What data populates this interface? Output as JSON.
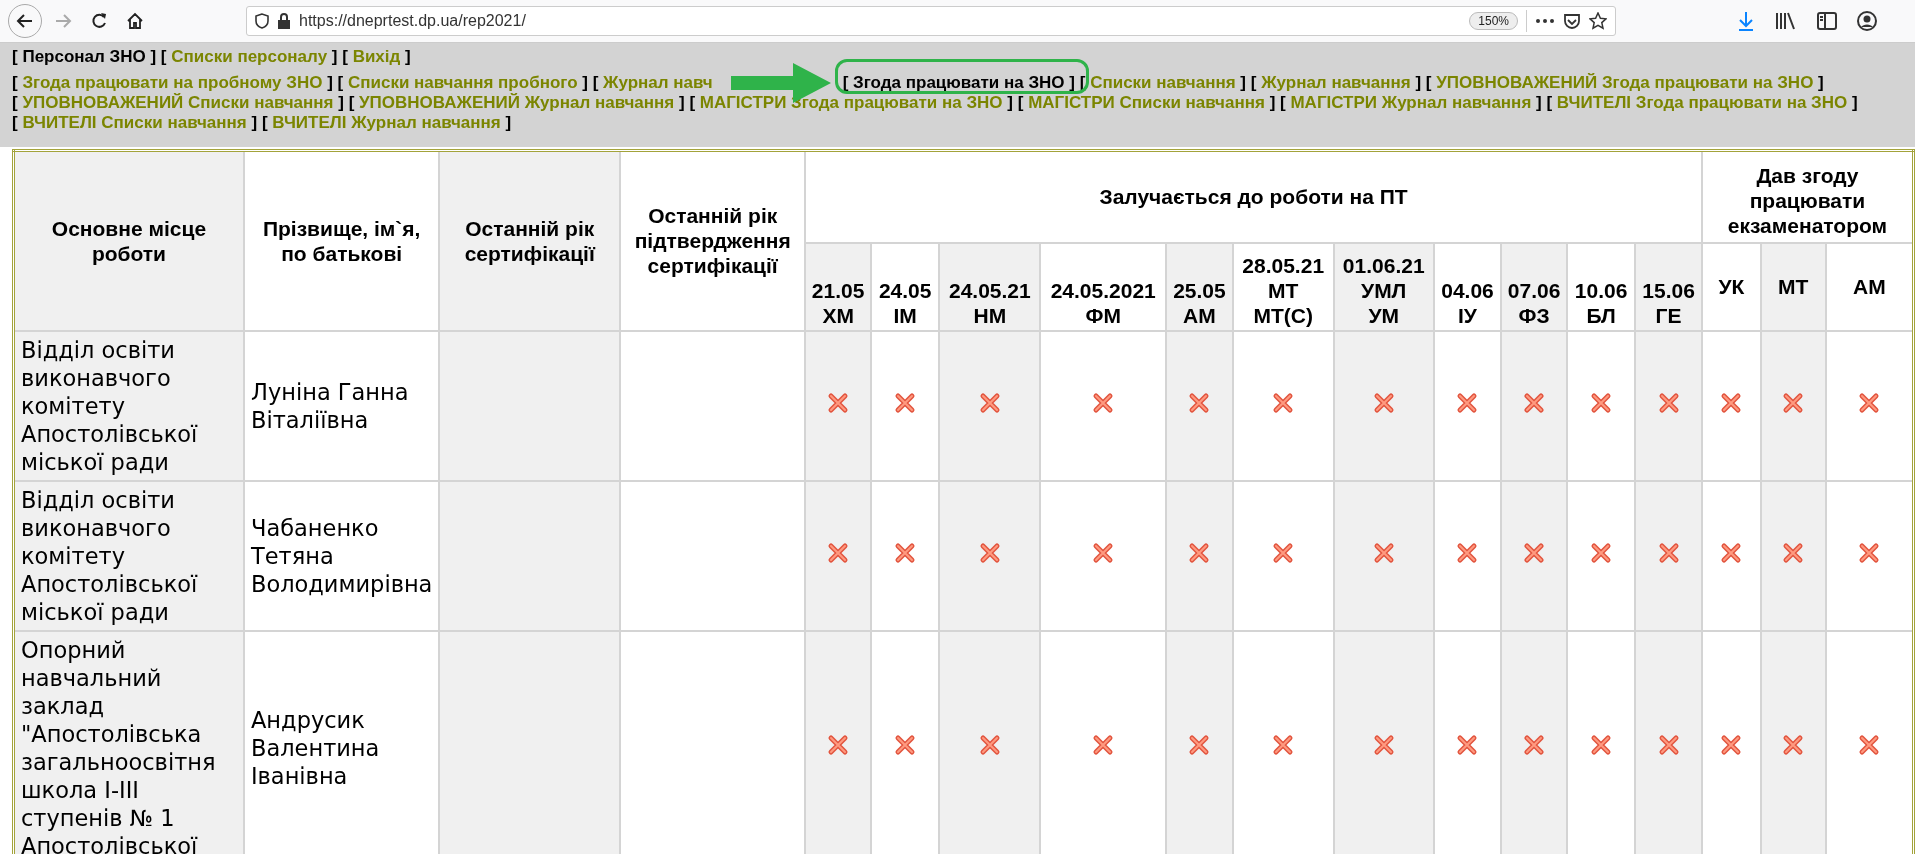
{
  "browser": {
    "url": "https://dneprtest.dp.ua/rep2021/",
    "zoom": "150%"
  },
  "nav": {
    "main": [
      {
        "before": "[",
        "label": "Персонал ЗНО",
        "after": "]",
        "selected": true,
        "highlighted": false
      },
      {
        "before": "[",
        "label": "Списки персоналу",
        "after": "]",
        "selected": false,
        "highlighted": false
      },
      {
        "before": "[",
        "label": "Вихід",
        "after": "]",
        "selected": false,
        "highlighted": false
      }
    ],
    "lines": [
      [
        {
          "before": "[",
          "label": "Згода працювати на пробному ЗНО",
          "after": "]",
          "selected": false,
          "highlighted": false
        },
        {
          "before": "[",
          "label": "Списки навчання пробного",
          "after": "]",
          "selected": false,
          "highlighted": false
        },
        {
          "before": "[",
          "label": "Журнал навч",
          "selected": false,
          "highlighted": false
        },
        {
          "before": "[",
          "label": "Згода працювати на ЗНО",
          "after": "]",
          "selected": true,
          "highlighted": true
        },
        {
          "before": "[",
          "label": "Списки навчання",
          "after": "]",
          "selected": false,
          "highlighted": false
        },
        {
          "before": "[",
          "label": "Журнал навчання",
          "after": "]",
          "selected": false,
          "highlighted": false
        },
        {
          "before": "[",
          "label": "УПОВНОВАЖЕНИЙ Згода працювати на ЗНО",
          "after": "]",
          "selected": false,
          "highlighted": false
        }
      ],
      [
        {
          "before": "[",
          "label": "УПОВНОВАЖЕНИЙ Списки навчання",
          "after": "]",
          "selected": false,
          "highlighted": false
        },
        {
          "before": "[",
          "label": "УПОВНОВАЖЕНИЙ Журнал навчання",
          "after": "]",
          "selected": false,
          "highlighted": false
        },
        {
          "before": "[",
          "label": "МАГІСТРИ Згода працювати на ЗНО",
          "after": "]",
          "selected": false,
          "highlighted": false
        },
        {
          "before": "[",
          "label": "МАГІСТРИ Списки навчання",
          "after": "]",
          "selected": false,
          "highlighted": false
        },
        {
          "before": "[",
          "label": "МАГІСТРИ Журнал навчання",
          "after": "]",
          "selected": false,
          "highlighted": false
        },
        {
          "before": "[",
          "label": "ВЧИТЕЛІ Згода працювати на ЗНО",
          "after": "]",
          "selected": false,
          "highlighted": false
        }
      ],
      [
        {
          "before": "[",
          "label": "ВЧИТЕЛІ Списки навчання",
          "after": "]",
          "selected": false,
          "highlighted": false
        },
        {
          "before": "[",
          "label": "ВЧИТЕЛІ Журнал навчання",
          "after": "]",
          "selected": false,
          "highlighted": false
        }
      ]
    ]
  },
  "table": {
    "columns": [
      "Основне місце роботи",
      "Прізвище, ім`я, по батькові",
      "Останній рік сертифікації",
      "Останній рік підтвердження сертифікації"
    ],
    "pt_group": "Залучається до роботи на ПТ",
    "pt_columns": [
      [
        "21.05",
        "ХМ"
      ],
      [
        "24.05",
        "ІМ"
      ],
      [
        "24.05.21",
        "НМ"
      ],
      [
        "24.05.2021",
        "ФМ"
      ],
      [
        "25.05",
        "АМ"
      ],
      [
        "28.05.21",
        "МТ",
        "МТ(С)"
      ],
      [
        "01.06.21",
        "УМЛ",
        "УМ"
      ],
      [
        "04.06",
        "ІУ"
      ],
      [
        "07.06",
        "ФЗ"
      ],
      [
        "10.06",
        "БЛ"
      ],
      [
        "15.06",
        "ГЕ"
      ]
    ],
    "exam_group": "Дав згоду працювати екзаменатором",
    "exam_columns": [
      "УК",
      "МТ",
      "АМ"
    ],
    "rows": [
      {
        "workplace": "Відділ освіти виконавчого комітету Апостолівської міської ради",
        "name": "Луніна Ганна Віталіївна",
        "pt": [
          {
            "on": false
          },
          {
            "on": false
          },
          {
            "on": false
          },
          {
            "on": false
          },
          {
            "on": false
          },
          {
            "on": false
          },
          {
            "on": false
          },
          {
            "on": false
          },
          {
            "on": false
          },
          {
            "on": false
          },
          {
            "on": false
          }
        ],
        "exam": [
          {
            "on": false
          },
          {
            "on": false
          },
          {
            "on": false
          }
        ]
      },
      {
        "workplace": "Відділ освіти виконавчого комітету Апостолівської міської ради",
        "name": "Чабаненко Тетяна Володимирівна",
        "pt": [
          {
            "on": false
          },
          {
            "on": false
          },
          {
            "on": false
          },
          {
            "on": false
          },
          {
            "on": false
          },
          {
            "on": false
          },
          {
            "on": false
          },
          {
            "on": false
          },
          {
            "on": false
          },
          {
            "on": false
          },
          {
            "on": false
          }
        ],
        "exam": [
          {
            "on": false
          },
          {
            "on": false
          },
          {
            "on": false
          }
        ]
      },
      {
        "workplace": "Опорний навчальний заклад \"Апостолівська загальноосвітня школа I-III ступенів № 1 Апостолівської",
        "name": "Андрусик Валентина Іванівна",
        "pt": [
          {
            "on": false
          },
          {
            "on": false
          },
          {
            "on": false
          },
          {
            "on": false
          },
          {
            "on": false
          },
          {
            "on": false
          },
          {
            "on": false
          },
          {
            "on": false
          },
          {
            "on": false
          },
          {
            "on": false
          },
          {
            "on": false
          }
        ],
        "exam": [
          {
            "on": false
          },
          {
            "on": false
          },
          {
            "on": false
          }
        ]
      }
    ]
  }
}
